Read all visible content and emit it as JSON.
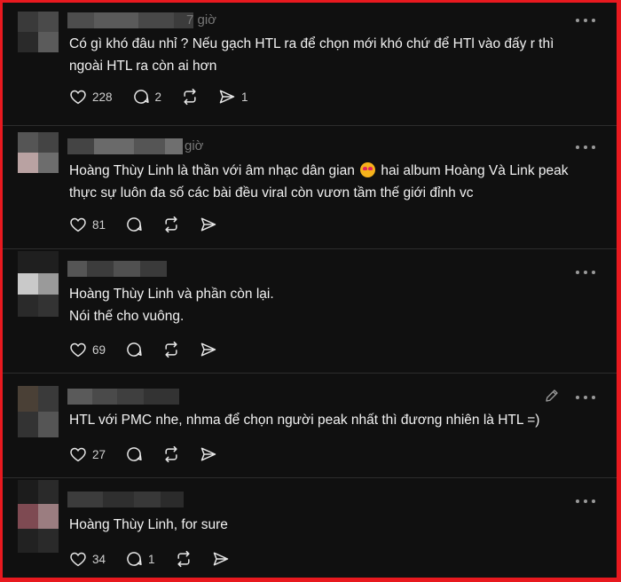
{
  "posts": [
    {
      "time": "7 giờ",
      "text": "Có gì khó đâu nhỉ ? Nếu gạch HTL ra để chọn mới khó chứ để HTl vào đấy r thì\nngoài HTL ra còn ai hơn",
      "likes": "228",
      "comments": "2",
      "reposts": "",
      "shares": "1"
    },
    {
      "time": "giờ",
      "text_before_emoji": "Hoàng Thùy Linh là thần với âm nhạc dân gian ",
      "emoji": "smiling-face-with-heart-eyes",
      "text_after_emoji": " hai album Hoàng Và Link peak\nthực sự luôn đa số các bài đều viral còn vươn tầm thế giới đỉnh vc",
      "likes": "81",
      "comments": "",
      "reposts": "",
      "shares": ""
    },
    {
      "time": "",
      "text": "Hoàng Thùy Linh và phần còn lại.\nNói thế cho vuông.",
      "likes": "69",
      "comments": "",
      "reposts": "",
      "shares": ""
    },
    {
      "time": "",
      "text": "HTL với PMC nhe, nhma để chọn người peak nhất thì đương nhiên là HTL =)",
      "likes": "27",
      "comments": "",
      "reposts": "",
      "shares": ""
    },
    {
      "time": "",
      "text": "Hoàng Thùy Linh, for sure",
      "likes": "34",
      "comments": "1",
      "reposts": "",
      "shares": ""
    }
  ],
  "icons": {
    "like": "heart-icon",
    "comment": "comment-icon",
    "repost": "repost-icon",
    "share": "send-icon",
    "more": "more-options-icon",
    "edit": "edit-pencil-icon"
  },
  "colors": {
    "frame_border": "#e8191f",
    "background": "#101010",
    "text": "#f1f1f1",
    "muted": "#777777"
  }
}
